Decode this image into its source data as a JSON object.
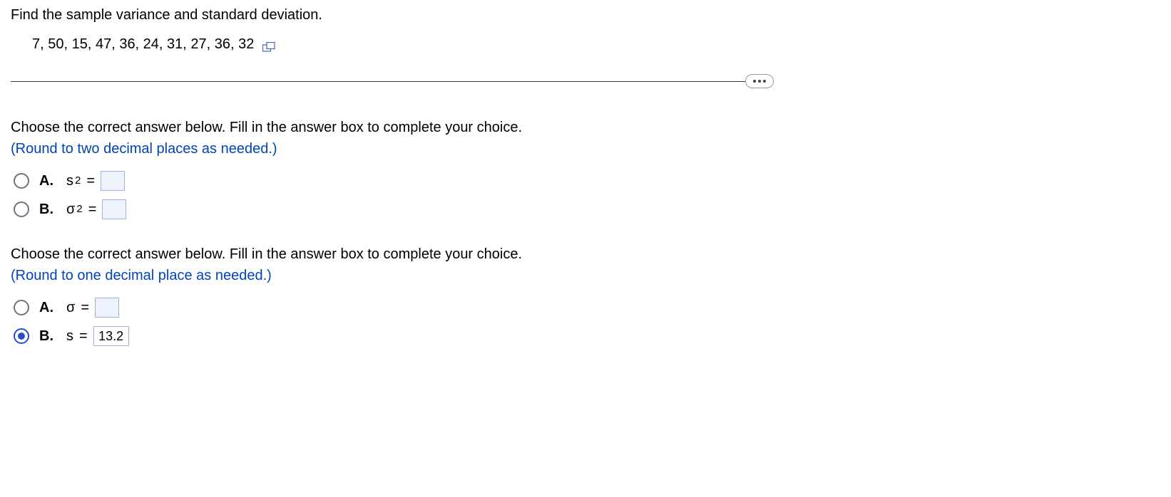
{
  "question": {
    "prompt": "Find the sample variance and standard deviation.",
    "data_values": "7, 50, 15, 47, 36, 24, 31, 27, 36, 32"
  },
  "part1": {
    "instruction": "Choose the correct answer below. Fill in the answer box to complete your choice.",
    "rounding": "(Round to two decimal places as needed.)",
    "optionA": {
      "label": "A.",
      "symbol": "s",
      "exp": "2",
      "value": ""
    },
    "optionB": {
      "label": "B.",
      "symbol": "σ",
      "exp": "2",
      "value": ""
    }
  },
  "part2": {
    "instruction": "Choose the correct answer below. Fill in the answer box to complete your choice.",
    "rounding": "(Round to one decimal place as needed.)",
    "optionA": {
      "label": "A.",
      "symbol": "σ",
      "value": ""
    },
    "optionB": {
      "label": "B.",
      "symbol": "s",
      "value": "13.2"
    }
  }
}
